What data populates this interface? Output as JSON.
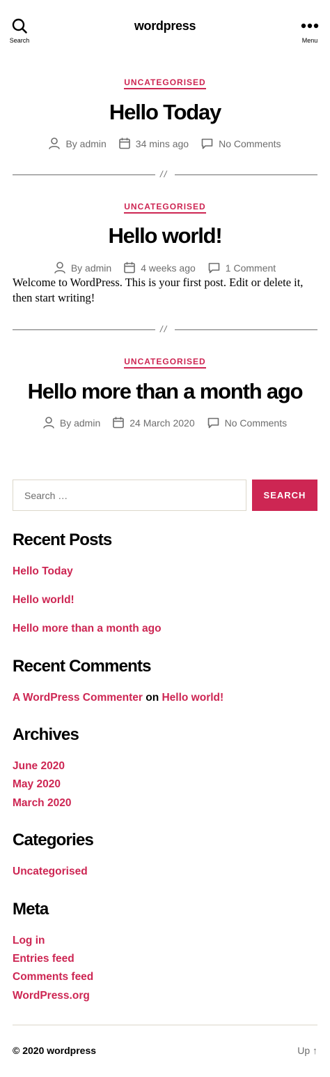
{
  "header": {
    "search_label": "Search",
    "site_title": "wordpress",
    "menu_label": "Menu"
  },
  "posts": [
    {
      "category": "UNCATEGORISED",
      "title": "Hello Today",
      "author": "By admin",
      "date": "34 mins ago",
      "comments": "No Comments"
    },
    {
      "category": "UNCATEGORISED",
      "title": "Hello world!",
      "author": "By admin",
      "date": "4 weeks ago",
      "comments": "1 Comment",
      "excerpt": "Welcome to WordPress. This is your first post. Edit or delete it, then start writing!"
    },
    {
      "category": "UNCATEGORISED",
      "title": "Hello more than a month ago",
      "author": "By admin",
      "date": "24 March 2020",
      "comments": "No Comments"
    }
  ],
  "separator": "//",
  "search": {
    "placeholder": "Search …",
    "button": "SEARCH"
  },
  "widgets": {
    "recent_posts": {
      "title": "Recent Posts",
      "items": [
        "Hello Today",
        "Hello world!",
        "Hello more than a month ago"
      ]
    },
    "recent_comments": {
      "title": "Recent Comments",
      "author": "A WordPress Commenter",
      "on": "on",
      "post": "Hello world!"
    },
    "archives": {
      "title": "Archives",
      "items": [
        "June 2020",
        "May 2020",
        "March 2020"
      ]
    },
    "categories": {
      "title": "Categories",
      "items": [
        "Uncategorised"
      ]
    },
    "meta": {
      "title": "Meta",
      "items": [
        "Log in",
        "Entries feed",
        "Comments feed",
        "WordPress.org"
      ]
    }
  },
  "footer": {
    "copyright": "© 2020 wordpress",
    "up": "Up ↑"
  },
  "colors": {
    "accent": "#cd2653",
    "meta_text": "#6d6d6d",
    "border": "#dcd7ca"
  }
}
